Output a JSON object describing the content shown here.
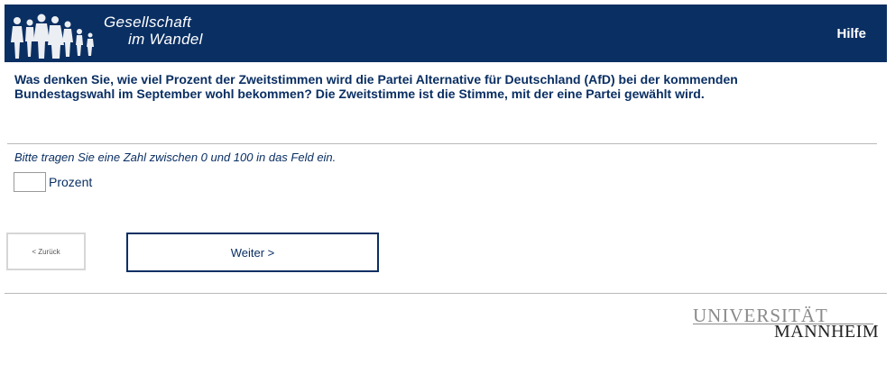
{
  "header": {
    "brand_line1": "Gesellschaft",
    "brand_line2": "im Wandel",
    "help_label": "Hilfe",
    "logo_icon": "people-silhouettes-icon"
  },
  "question": {
    "text": "Was denken Sie, wie viel Prozent der Zweitstimmen wird die Partei Alternative für Deutschland (AfD) bei der kommenden Bundestagswahl im September wohl bekommen? Die Zweitstimme ist die Stimme, mit der eine Partei gewählt wird."
  },
  "answer": {
    "hint": "Bitte tragen Sie eine Zahl zwischen 0 und 100 in das Feld ein.",
    "value": "",
    "unit": "Prozent"
  },
  "nav": {
    "back_label": "< Zurück",
    "next_label": "Weiter >"
  },
  "footer": {
    "university_line1": "UNIVERSITÄT",
    "university_line2": "MANNHEIM"
  },
  "colors": {
    "brand_blue": "#0a2f63",
    "divider": "#b9b9b9"
  }
}
